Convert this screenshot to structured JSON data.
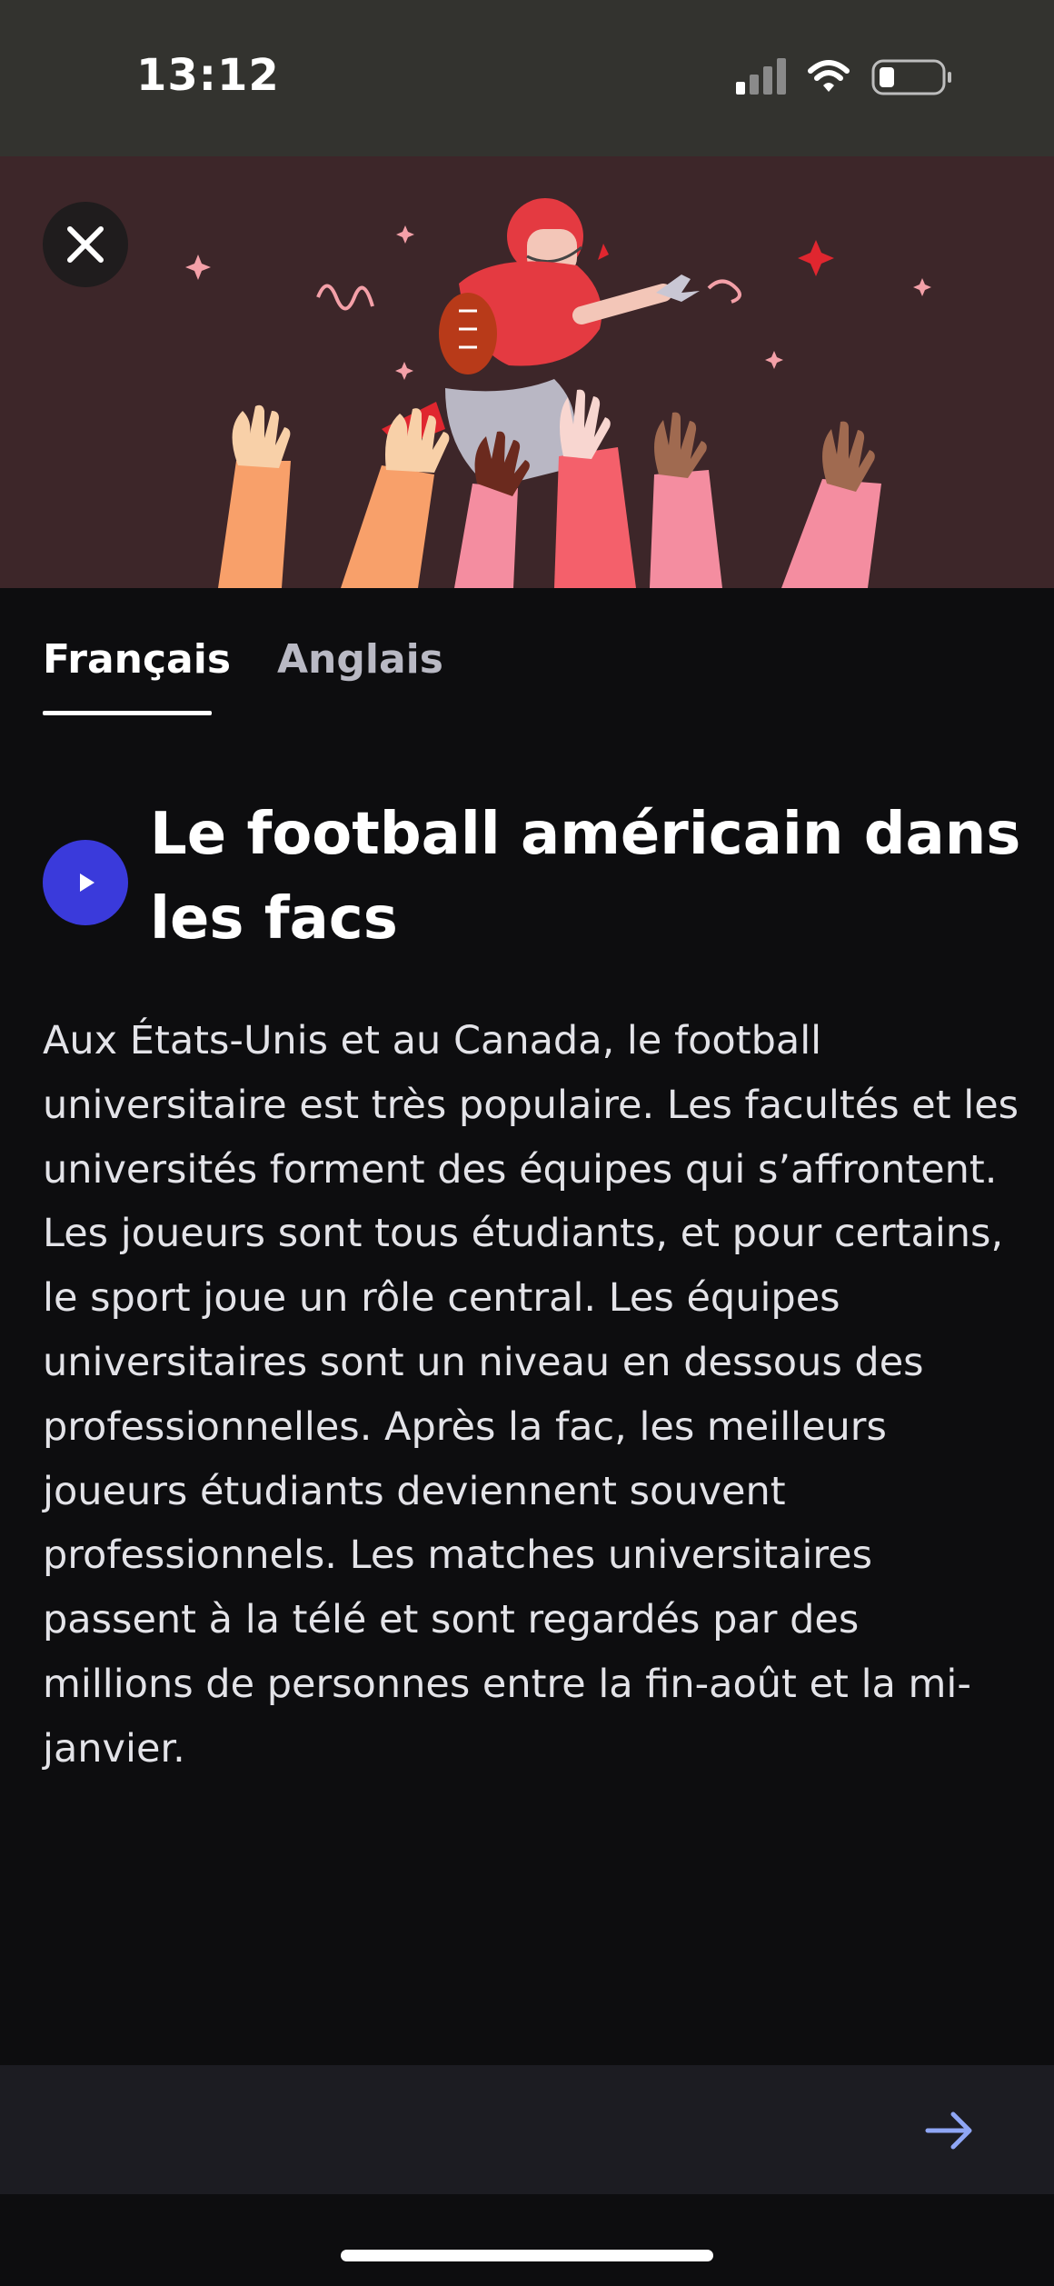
{
  "status_bar": {
    "time": "13:12"
  },
  "hero": {
    "close_icon": "close-icon"
  },
  "tabs": [
    {
      "label": "Français",
      "active": true
    },
    {
      "label": "Anglais",
      "active": false
    }
  ],
  "article": {
    "play_icon": "play-icon",
    "title": "Le football américain dans les facs",
    "body": "Aux États-Unis et au Canada, le football universitaire est très populaire. Les facultés et les universités forment des équipes qui s’affrontent. Les joueurs sont tous étudiants, et pour certains, le sport joue un rôle central. Les équipes universitaires sont un niveau en dessous des professionnelles. Après la fac, les meilleurs joueurs étudiants deviennent souvent professionnels. Les matches universitaires passent à la télé et sont regardés par des millions de personnes entre la fin-août et la mi-janvier."
  },
  "bottom_bar": {
    "next_icon": "arrow-right-icon"
  },
  "colors": {
    "background": "#0d0d0f",
    "status_bar": "#33332f",
    "hero_bg": "#3d2629",
    "accent_play": "#3a3adb",
    "arrow": "#8fa6f5"
  }
}
